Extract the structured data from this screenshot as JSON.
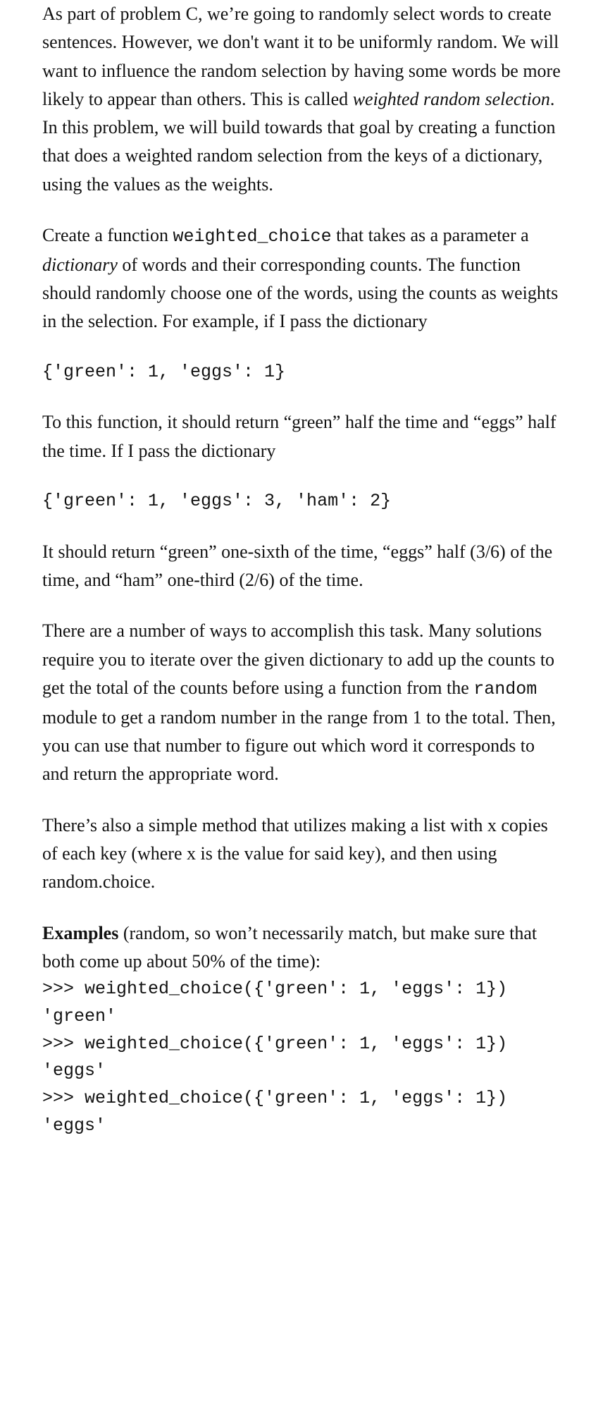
{
  "para1a": "As part of problem C, we’re going to randomly select words to create sentences. However, we don't want it to be uniformly random. We will want to influence the random selection by having some words be more likely to appear than others. This is called ",
  "para1_em": "weighted random selection",
  "para1b": ". In this problem, we will build towards that goal by creating a function that does a weighted random selection from the keys of a dictionary, using the values as the weights.",
  "para2a": "Create a function ",
  "para2_code": "weighted_choice",
  "para2b": " that takes as a parameter a ",
  "para2_em": "dictionary",
  "para2c": " of words and their corresponding counts. The function should randomly choose one of the words, using the counts as weights in the selection. For example, if I pass the dictionary",
  "code1": "{'green': 1, 'eggs': 1}",
  "para3": "To this function, it should return “green” half the time and “eggs” half the time. If I pass the dictionary",
  "code2": "{'green': 1, 'eggs': 3, 'ham': 2}",
  "para4": "It should return “green” one-sixth of the time, “eggs” half (3/6) of the time, and “ham” one-third (2/6) of the time.",
  "para5a": "There are a number of ways to accomplish this task. Many solutions require you to iterate over the given dictionary to add up the counts to get the total of the counts before using a function from the ",
  "para5_code": "random",
  "para5b": " module to get a random number in the range from 1 to the total. Then, you can use that number to figure out which word it corresponds to and return the appropriate word.",
  "para6": "There’s also a simple method that utilizes making a list with x copies of each key (where x is the value for said key), and then using random.choice.",
  "examples_label": "Examples",
  "examples_intro": " (random, so won’t necessarily match, but make sure that both come up about 50% of the time):",
  "examples_code": ">>> weighted_choice({'green': 1, 'eggs': 1})\n'green'\n>>> weighted_choice({'green': 1, 'eggs': 1})\n'eggs'\n>>> weighted_choice({'green': 1, 'eggs': 1})\n'eggs'"
}
